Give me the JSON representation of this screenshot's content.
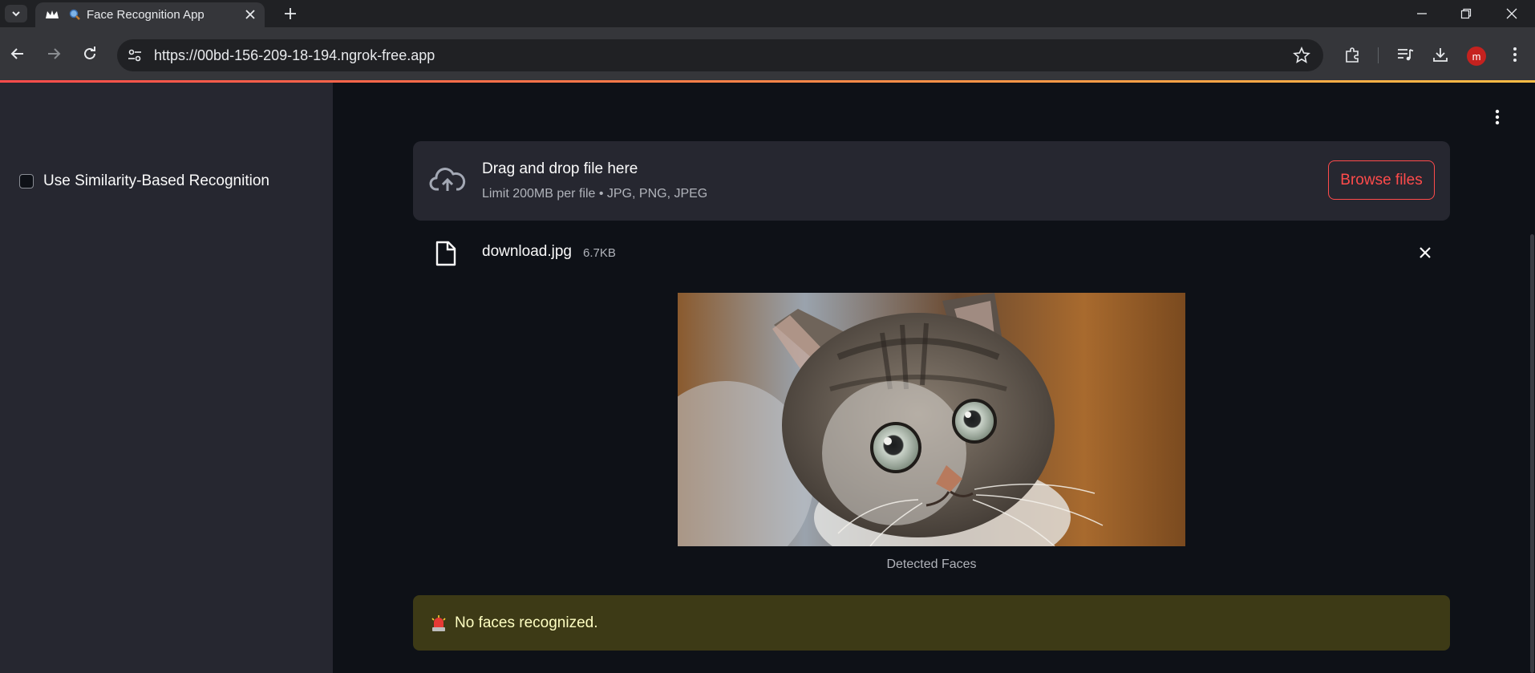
{
  "browser": {
    "tab_title": "Face Recognition App",
    "url": "https://00bd-156-209-18-194.ngrok-free.app",
    "profile_initial": "m"
  },
  "sidebar": {
    "similarity_checkbox": {
      "label": "Use Similarity-Based Recognition",
      "checked": false
    }
  },
  "uploader": {
    "title": "Drag and drop file here",
    "limit": "Limit 200MB per file • JPG, PNG, JPEG",
    "browse_label": "Browse files",
    "file": {
      "name": "download.jpg",
      "size": "6.7KB"
    }
  },
  "result": {
    "image_caption": "Detected Faces",
    "warning_text": "No faces recognized."
  },
  "colors": {
    "accent": "#ff4b4b",
    "sidebar_bg": "#262730",
    "main_bg": "#0e1117",
    "warning_bg": "#3d3a16",
    "warning_text": "#ffffc2"
  }
}
